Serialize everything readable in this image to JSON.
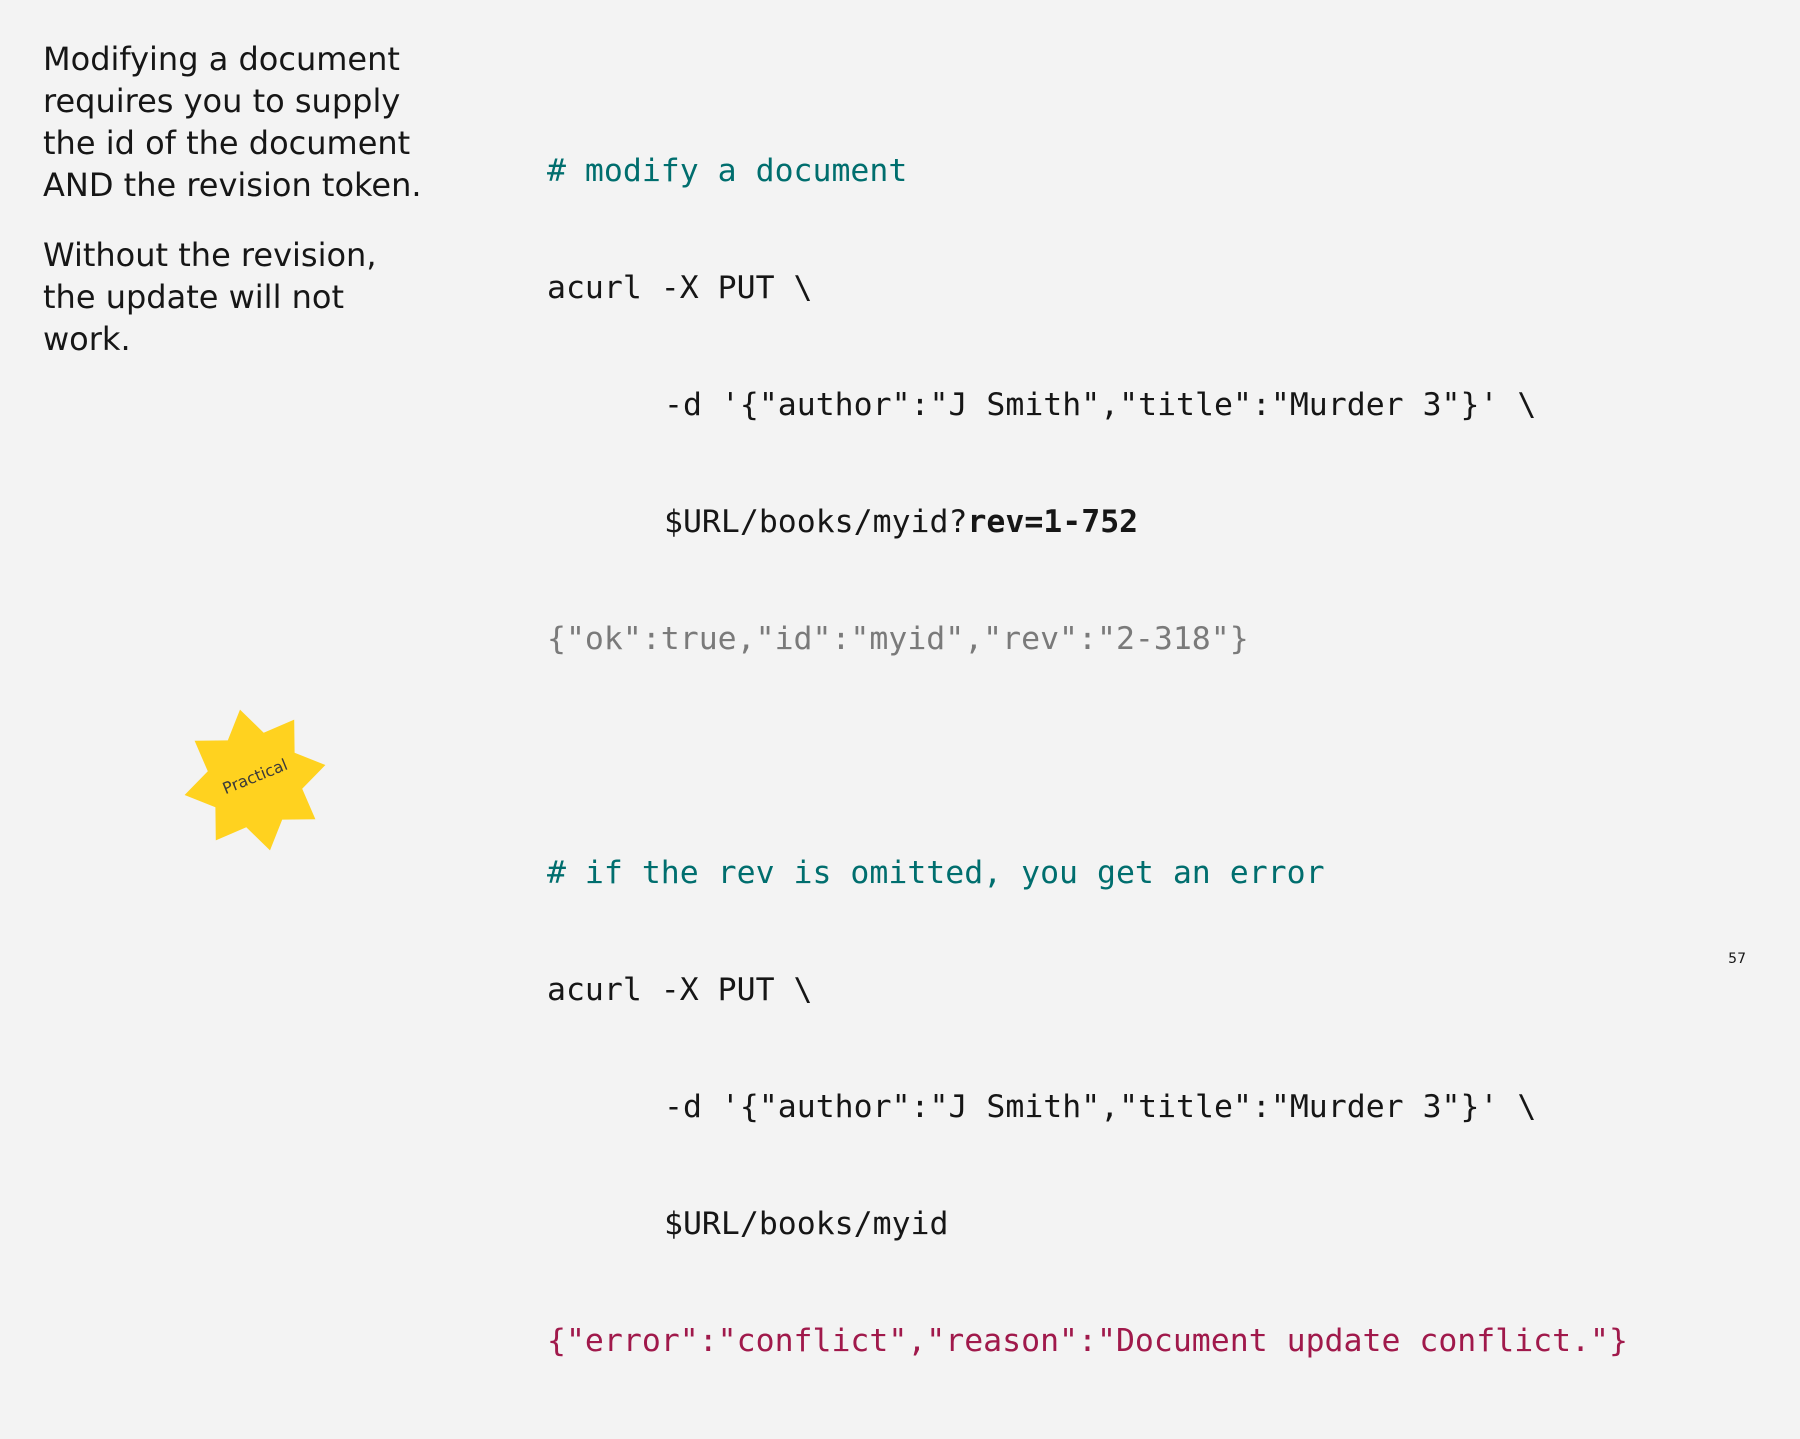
{
  "intro": {
    "paragraph1": "Modifying a document requires you to supply the id of the document AND the revision token.",
    "paragraph2": "Without the revision, the update will not work."
  },
  "code": {
    "block1": {
      "comment": "# modify a document",
      "line1": "acurl -X PUT \\",
      "line2": "-d '{\"author\":\"J Smith\",\"title\":\"Murder 3\"}' \\",
      "line3_prefix": "$URL/books/myid?",
      "line3_bold": "rev=1-752",
      "response": "{\"ok\":true,\"id\":\"myid\",\"rev\":\"2-318\"}"
    },
    "block2": {
      "comment": "# if the rev is omitted, you get an error",
      "line1": "acurl -X PUT \\",
      "line2": "-d '{\"author\":\"J Smith\",\"title\":\"Murder 3\"}' \\",
      "line3": "$URL/books/myid",
      "response": "{\"error\":\"conflict\",\"reason\":\"Document update conflict.\"}"
    }
  },
  "badge": {
    "label": "Practical",
    "color": "#ffd21f",
    "icon": "starburst-badge-icon"
  },
  "page_number": "57",
  "colors": {
    "background": "#f3f3f3",
    "comment": "#006e6e",
    "ok_response": "#7a7a7a",
    "error_response": "#a0194b"
  }
}
